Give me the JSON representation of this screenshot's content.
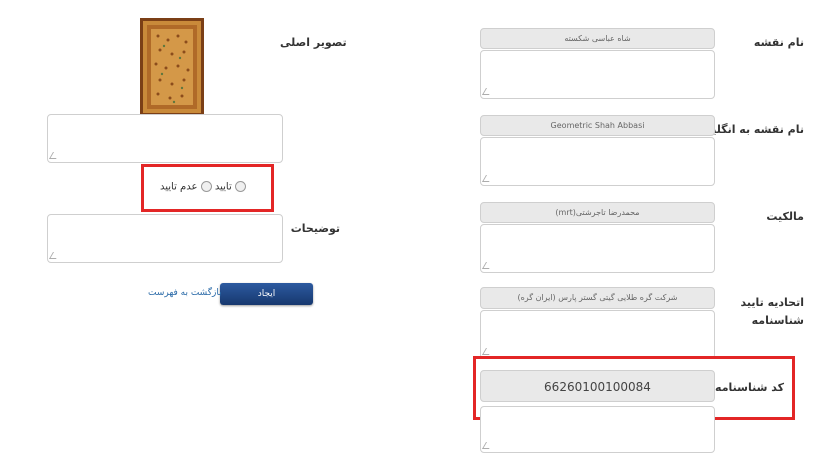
{
  "right_form": {
    "design_name": {
      "label": "نام نقشه",
      "value": "شاه عباسی شکسته"
    },
    "design_name_en": {
      "label": "نام نقشه به انگلیسی",
      "value": "Geometric Shah Abbasi"
    },
    "owner": {
      "label": "مالکیت",
      "value": "محمدرضا تاجرشتی(mrt)"
    },
    "certificate_union": {
      "label": "اتحادیه تایید شناسنامه",
      "value": "شرکت گره طلایی گیتی گستر پارس (ایران گره)"
    },
    "certificate_code": {
      "label": "کد شناسنامه",
      "value": "66260100100084"
    }
  },
  "left_form": {
    "original_image_label": "تصویر اصلی",
    "approval": {
      "approve_label": "تایید",
      "reject_label": "عدم تایید"
    },
    "description_label": "توضیحات",
    "create_button": "ایجاد",
    "back_link": "بازگشت به فهرست"
  },
  "colors": {
    "highlight": "#e32626",
    "button": "#1f4585",
    "link": "#2a6aa8"
  }
}
